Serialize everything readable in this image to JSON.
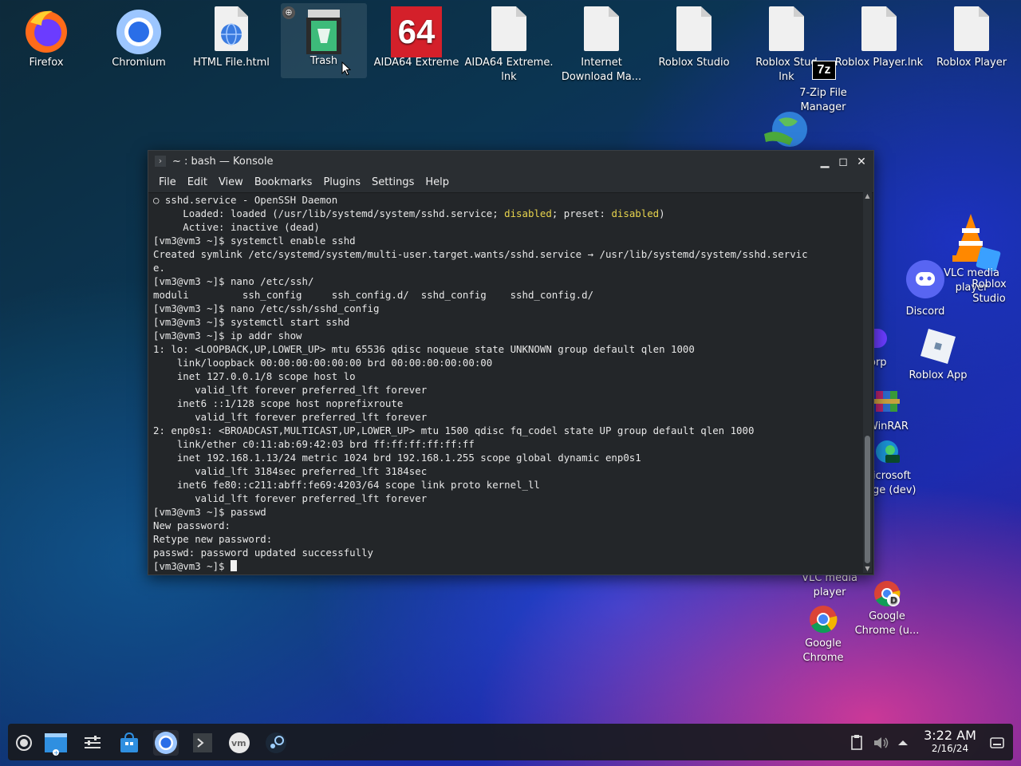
{
  "desktop_icons": {
    "firefox": "Firefox",
    "chromium": "Chromium",
    "html_file": "HTML File.html",
    "trash": "Trash",
    "aida64": "AIDA64 Extreme",
    "aida64_lnk": "AIDA64 Extreme.\nlnk",
    "idm": "Internet\nDownload Ma...",
    "roblox_studio": "Roblox Studio",
    "roblox_stud_lnk": "Roblox Stud\nlnk",
    "roblox_player_lnk": "Roblox Player.lnk",
    "roblox_player": "Roblox Player",
    "sevenzip": "7-Zip File\nManager",
    "vlc_top": "VLC media\nplayer",
    "roblox_studio2": "Roblox\nStudio",
    "discord": "Discord",
    "orp": "orp",
    "roblox_app": "Roblox App",
    "winrar": "WinRAR",
    "edge_dev": "icrosoft\nge (dev)",
    "vlc_bottom": "VLC media\nplayer",
    "google_chrome": "Google\nChrome",
    "google_chrome_u": "Google\nChrome (u..."
  },
  "aida64_badge": "64",
  "sevenzip_badge": "7z",
  "konsole": {
    "title": "~ : bash — Konsole",
    "menu": [
      "File",
      "Edit",
      "View",
      "Bookmarks",
      "Plugins",
      "Settings",
      "Help"
    ],
    "lines": [
      "○ sshd.service - OpenSSH Daemon",
      "     Loaded: loaded (/usr/lib/systemd/system/sshd.service; ",
      "     Active: inactive (dead)",
      "[vm3@vm3 ~]$ systemctl enable sshd",
      "Created symlink /etc/systemd/system/multi-user.target.wants/sshd.service → /usr/lib/systemd/system/sshd.servic",
      "e.",
      "[vm3@vm3 ~]$ nano /etc/ssh/",
      "moduli         ssh_config     ssh_config.d/  sshd_config    sshd_config.d/",
      "[vm3@vm3 ~]$ nano /etc/ssh/sshd_config",
      "[vm3@vm3 ~]$ systemctl start sshd",
      "[vm3@vm3 ~]$ ip addr show",
      "1: lo: <LOOPBACK,UP,LOWER_UP> mtu 65536 qdisc noqueue state UNKNOWN group default qlen 1000",
      "    link/loopback 00:00:00:00:00:00 brd 00:00:00:00:00:00",
      "    inet 127.0.0.1/8 scope host lo",
      "       valid_lft forever preferred_lft forever",
      "    inet6 ::1/128 scope host noprefixroute",
      "       valid_lft forever preferred_lft forever",
      "2: enp0s1: <BROADCAST,MULTICAST,UP,LOWER_UP> mtu 1500 qdisc fq_codel state UP group default qlen 1000",
      "    link/ether c0:11:ab:69:42:03 brd ff:ff:ff:ff:ff:ff",
      "    inet 192.168.1.13/24 metric 1024 brd 192.168.1.255 scope global dynamic enp0s1",
      "       valid_lft 3184sec preferred_lft 3184sec",
      "    inet6 fe80::c211:abff:fe69:4203/64 scope link proto kernel_ll",
      "       valid_lft forever preferred_lft forever",
      "[vm3@vm3 ~]$ passwd",
      "New password:",
      "Retype new password:",
      "passwd: password updated successfully",
      "[vm3@vm3 ~]$ "
    ],
    "loaded_disabled": "disabled",
    "loaded_mid": "; preset: ",
    "loaded_disabled2": "disabled",
    "loaded_end": ")"
  },
  "clock": {
    "time": "3:22 AM",
    "date": "2/16/24"
  },
  "colors": {
    "terminal_bg": "#232629",
    "highlight": "#e8d44d",
    "taskbar_bg": "#181a1e"
  }
}
